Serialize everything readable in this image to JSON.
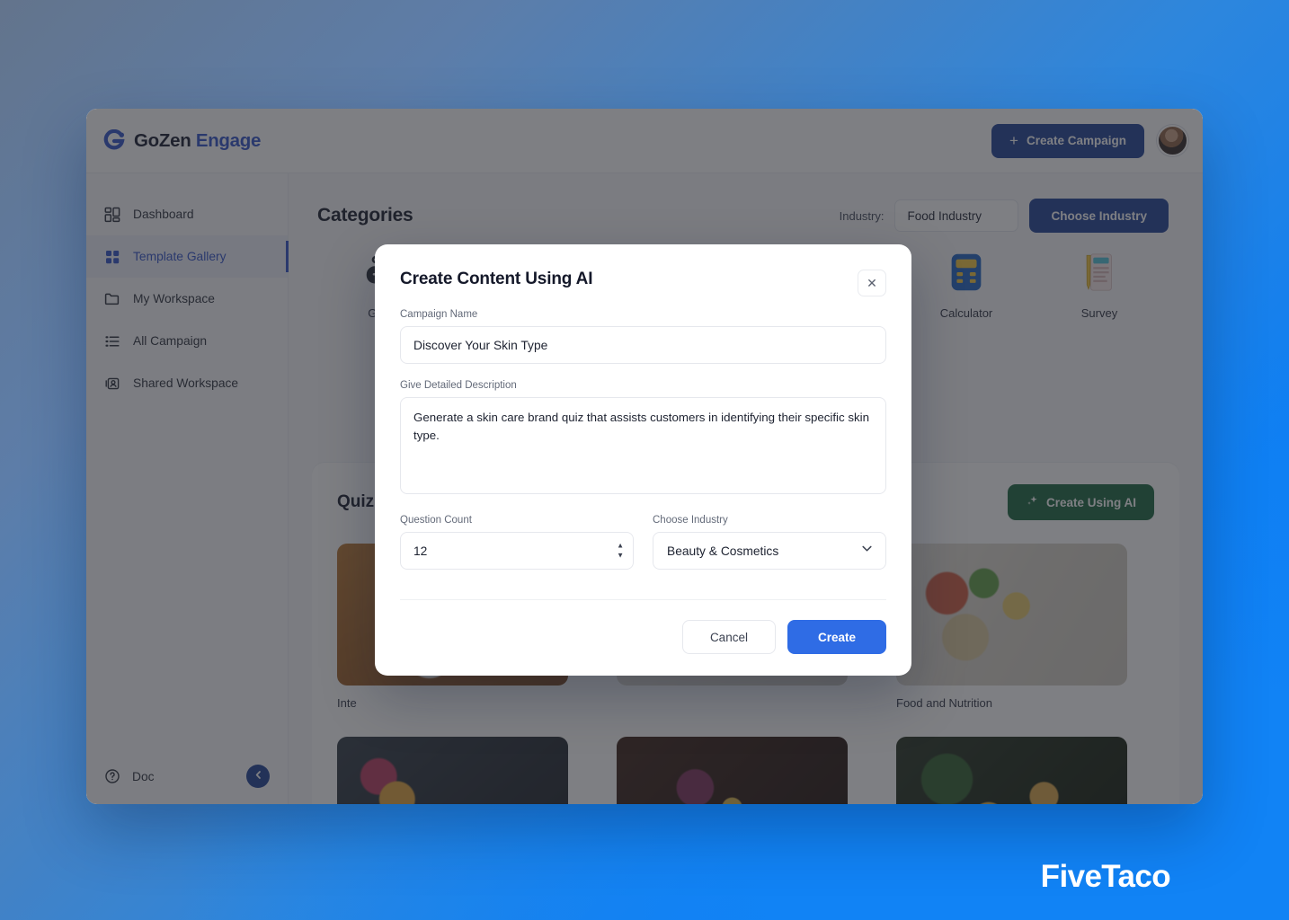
{
  "brand": {
    "name_dark": "GoZen",
    "name_accent": "Engage",
    "mark": "gozen-logo-icon"
  },
  "topbar": {
    "create_campaign_label": "Create Campaign",
    "plus_icon": "plus-icon",
    "avatar": "user-avatar"
  },
  "sidebar": {
    "items": [
      {
        "label": "Dashboard",
        "icon": "dashboard-icon",
        "active": false
      },
      {
        "label": "Template Gallery",
        "icon": "grid-icon",
        "active": true
      },
      {
        "label": "My Workspace",
        "icon": "folder-icon",
        "active": false
      },
      {
        "label": "All Campaign",
        "icon": "list-icon",
        "active": false
      },
      {
        "label": "Shared Workspace",
        "icon": "shared-user-icon",
        "active": false
      }
    ],
    "doc_label": "Doc",
    "doc_icon": "help-circle-icon",
    "collapse_icon": "chevron-left-icon"
  },
  "main": {
    "page_title": "Categories",
    "industry_label": "Industry:",
    "industry_value": "Food Industry",
    "choose_industry_label": "Choose Industry",
    "categories": [
      {
        "label": "Game",
        "icon": "gamepad-icon"
      },
      {
        "label": "Calculator",
        "icon": "calculator-icon"
      },
      {
        "label": "Survey",
        "icon": "survey-icon"
      }
    ],
    "panel_title": "Quiz",
    "create_using_ai_label": "Create Using AI",
    "sparkle_icon": "sparkle-icon",
    "cards": [
      {
        "label": "Inte",
        "thumb": "t1"
      },
      {
        "label": "",
        "thumb": "t2"
      },
      {
        "label": "Food and Nutrition",
        "thumb": "t2"
      },
      {
        "label": "",
        "thumb": "t3"
      },
      {
        "label": "",
        "thumb": "t4"
      },
      {
        "label": "",
        "thumb": "t5"
      }
    ]
  },
  "modal": {
    "title": "Create Content Using AI",
    "close_icon": "close-icon",
    "campaign_name_label": "Campaign Name",
    "campaign_name_value": "Discover Your Skin Type",
    "campaign_name_placeholder": "Campaign Name",
    "description_label": "Give Detailed Description",
    "description_value": "Generate a skin care brand quiz that assists customers in identifying their specific skin type.",
    "description_placeholder": "Give Detailed Description",
    "question_count_label": "Question Count",
    "question_count_value": "12",
    "industry_label": "Choose Industry",
    "industry_value": "Beauty & Cosmetics",
    "spinner_up_icon": "caret-up-icon",
    "spinner_down_icon": "caret-down-icon",
    "chevron_icon": "chevron-down-icon",
    "cancel_label": "Cancel",
    "create_label": "Create"
  },
  "watermark": {
    "text": "FiveTaco"
  },
  "colors": {
    "brand_accent": "#2f50c9",
    "primary_button": "#1d3f94",
    "create_button": "#2f6ce5",
    "ai_button": "#18653c",
    "background_blue": "#1183f5"
  }
}
